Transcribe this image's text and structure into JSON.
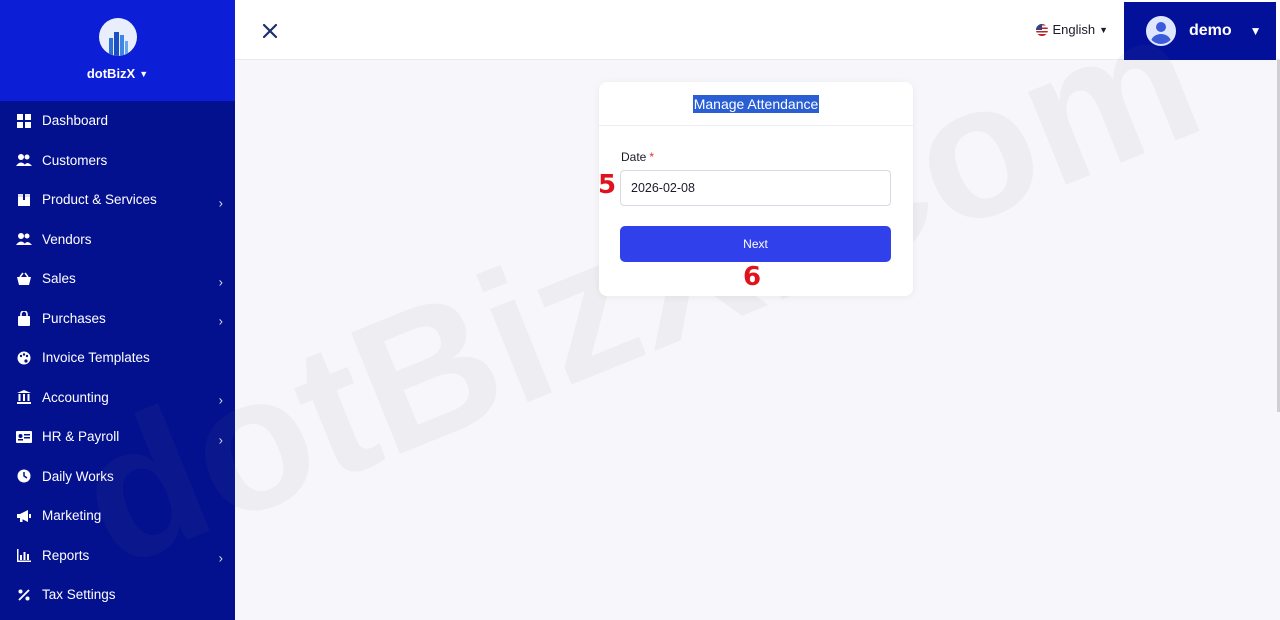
{
  "brand": {
    "name": "dotBizX"
  },
  "sidebar": {
    "items": [
      {
        "label": "Dashboard",
        "icon": "dashboard-icon",
        "has_submenu": false
      },
      {
        "label": "Customers",
        "icon": "users-icon",
        "has_submenu": false
      },
      {
        "label": "Product & Services",
        "icon": "box-icon",
        "has_submenu": true
      },
      {
        "label": "Vendors",
        "icon": "users-icon",
        "has_submenu": false
      },
      {
        "label": "Sales",
        "icon": "basket-icon",
        "has_submenu": true
      },
      {
        "label": "Purchases",
        "icon": "bag-icon",
        "has_submenu": true
      },
      {
        "label": "Invoice Templates",
        "icon": "palette-icon",
        "has_submenu": false
      },
      {
        "label": "Accounting",
        "icon": "bank-icon",
        "has_submenu": true
      },
      {
        "label": "HR & Payroll",
        "icon": "id-card-icon",
        "has_submenu": true
      },
      {
        "label": "Daily Works",
        "icon": "clock-icon",
        "has_submenu": false
      },
      {
        "label": "Marketing",
        "icon": "megaphone-icon",
        "has_submenu": false
      },
      {
        "label": "Reports",
        "icon": "bar-chart-icon",
        "has_submenu": true
      },
      {
        "label": "Tax Settings",
        "icon": "percent-icon",
        "has_submenu": false
      }
    ]
  },
  "header": {
    "language": "English",
    "user_name": "demo"
  },
  "card": {
    "title": "Manage Attendance",
    "date_label": "Date",
    "required_mark": "*",
    "date_value": "2026-02-08",
    "next_label": "Next"
  },
  "annotations": {
    "step_date": "5",
    "step_next": "6"
  },
  "watermark": "dotBizX.Com",
  "colors": {
    "sidebar": "#04118f",
    "brand_bg": "#0d1fd6",
    "accent": "#3040ea",
    "marker": "#e0131c"
  }
}
